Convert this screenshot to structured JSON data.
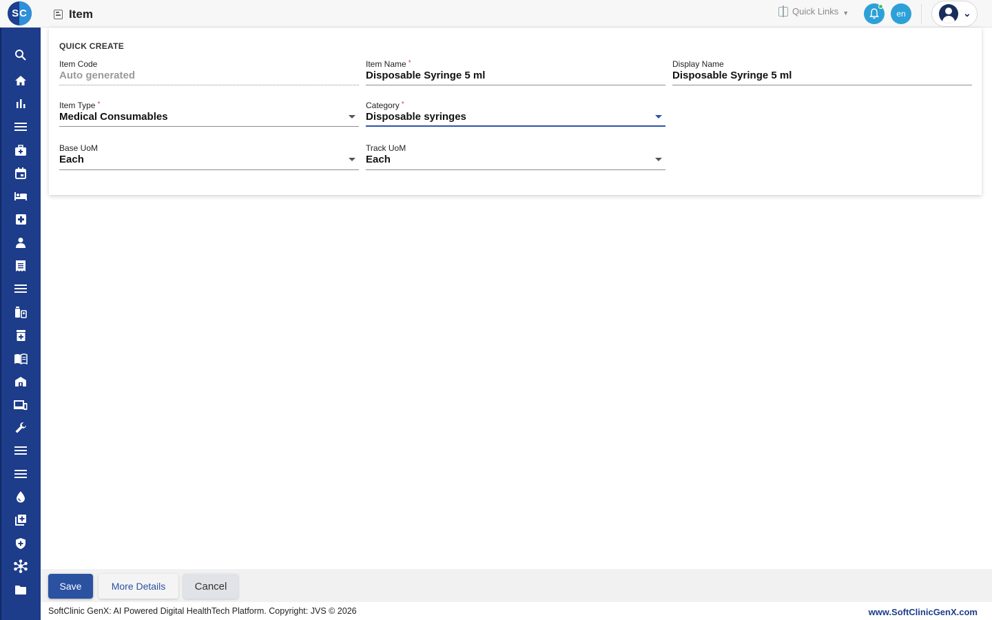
{
  "header": {
    "logo_text": "SC",
    "page_title": "Item",
    "quick_links_label": "Quick Links",
    "language": "en"
  },
  "sidebar": {
    "items": [
      {
        "icon": "search-icon"
      },
      {
        "icon": "home-icon"
      },
      {
        "icon": "bar-chart-icon"
      },
      {
        "icon": "menu-icon"
      },
      {
        "icon": "medical-bag-icon"
      },
      {
        "icon": "calendar-icon"
      },
      {
        "icon": "bed-icon"
      },
      {
        "icon": "medical-cross-icon"
      },
      {
        "icon": "person-icon"
      },
      {
        "icon": "receipt-icon"
      },
      {
        "icon": "menu-icon"
      },
      {
        "icon": "pharmacy-icon"
      },
      {
        "icon": "medicine-box-icon"
      },
      {
        "icon": "book-icon"
      },
      {
        "icon": "store-icon"
      },
      {
        "icon": "devices-icon"
      },
      {
        "icon": "wrench-icon"
      },
      {
        "icon": "menu-icon"
      },
      {
        "icon": "menu-icon"
      },
      {
        "icon": "blood-drop-icon"
      },
      {
        "icon": "add-library-icon"
      },
      {
        "icon": "shield-icon"
      },
      {
        "icon": "network-icon"
      },
      {
        "icon": "folder-icon"
      }
    ]
  },
  "form": {
    "heading": "QUICK CREATE",
    "item_code": {
      "label": "Item Code",
      "placeholder": "Auto generated"
    },
    "item_name": {
      "label": "Item Name",
      "value": "Disposable Syringe 5 ml",
      "required": "*"
    },
    "display_name": {
      "label": "Display Name",
      "value": "Disposable Syringe 5 ml"
    },
    "item_type": {
      "label": "Item Type",
      "value": "Medical Consumables",
      "required": "*"
    },
    "category": {
      "label": "Category",
      "value": "Disposable syringes",
      "required": "*"
    },
    "base_uom": {
      "label": "Base UoM",
      "value": "Each"
    },
    "track_uom": {
      "label": "Track UoM",
      "value": "Each"
    }
  },
  "actions": {
    "save": "Save",
    "more_details": "More Details",
    "cancel": "Cancel"
  },
  "footer": {
    "copyright": "SoftClinic GenX: AI Powered Digital HealthTech Platform. Copyright: JVS © 2026",
    "website": "www.SoftClinicGenX.com"
  },
  "colors": {
    "primary": "#1d3c8a",
    "accent": "#2da0d8",
    "button": "#2b51a1"
  }
}
